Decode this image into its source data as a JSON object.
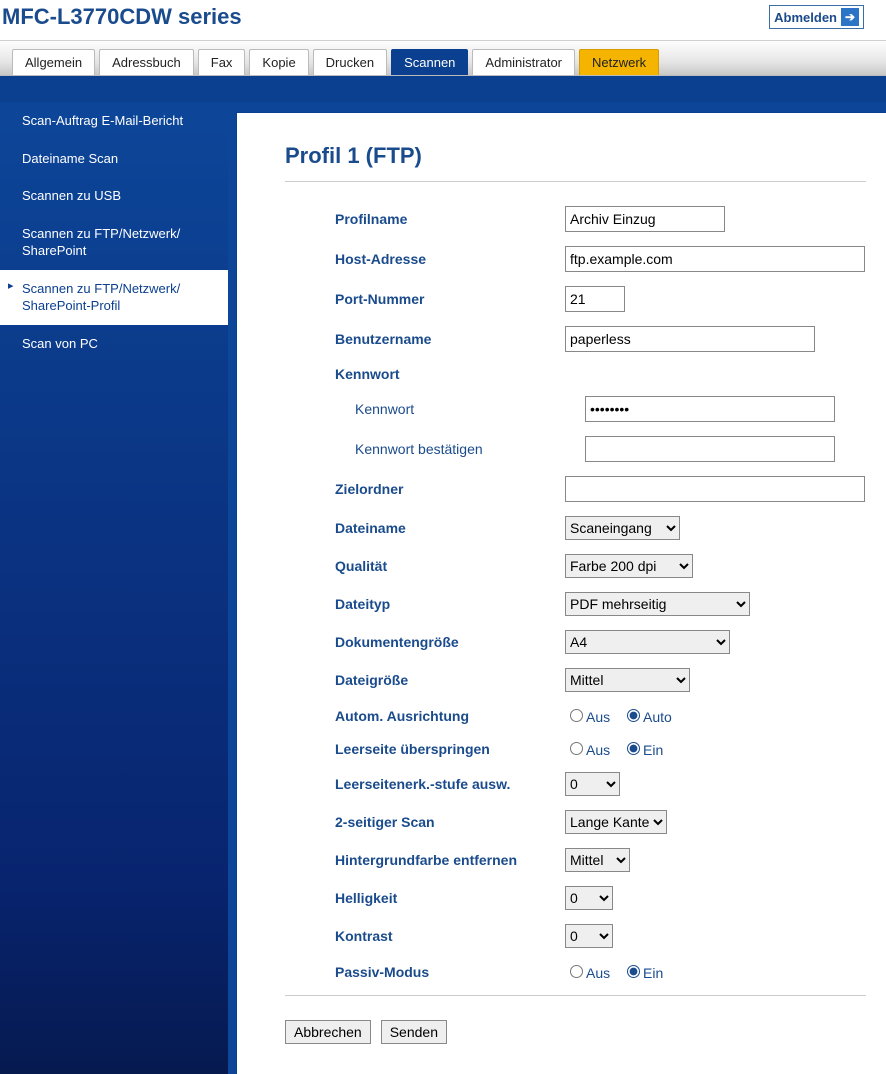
{
  "header": {
    "title": "MFC-L3770CDW series",
    "logout": "Abmelden"
  },
  "tabs": [
    {
      "label": "Allgemein"
    },
    {
      "label": "Adressbuch"
    },
    {
      "label": "Fax"
    },
    {
      "label": "Kopie"
    },
    {
      "label": "Drucken"
    },
    {
      "label": "Scannen",
      "active": true
    },
    {
      "label": "Administrator"
    },
    {
      "label": "Netzwerk",
      "net": true
    }
  ],
  "sidebar": [
    {
      "label": "Scan-Auftrag E-Mail-Bericht"
    },
    {
      "label": "Dateiname Scan"
    },
    {
      "label": "Scannen zu USB"
    },
    {
      "label": "Scannen zu FTP/Netzwerk/\nSharePoint"
    },
    {
      "label": "Scannen zu FTP/Netzwerk/\nSharePoint-Profil",
      "active": true
    },
    {
      "label": "Scan von PC"
    }
  ],
  "page": {
    "title": "Profil 1 (FTP)",
    "labels": {
      "profilname": "Profilname",
      "host": "Host-Adresse",
      "port": "Port-Nummer",
      "user": "Benutzername",
      "pw_section": "Kennwort",
      "pw": "Kennwort",
      "pw2": "Kennwort bestätigen",
      "folder": "Zielordner",
      "fname": "Dateiname",
      "quality": "Qualität",
      "ftype": "Dateityp",
      "docsize": "Dokumentengröße",
      "fsize": "Dateigröße",
      "auto_orient": "Autom. Ausrichtung",
      "skip_blank": "Leerseite überspringen",
      "blank_level": "Leerseitenerk.-stufe ausw.",
      "duplex": "2-seitiger Scan",
      "bg_remove": "Hintergrundfarbe entfernen",
      "bright": "Helligkeit",
      "contrast": "Kontrast",
      "passive": "Passiv-Modus"
    },
    "values": {
      "profilname": "Archiv Einzug",
      "host": "ftp.example.com",
      "port": "21",
      "user": "paperless",
      "pw": "••••••••",
      "pw2": "",
      "folder": "",
      "fname": "Scaneingang",
      "quality": "Farbe 200 dpi",
      "ftype": "PDF mehrseitig",
      "docsize": "A4",
      "fsize": "Mittel",
      "blank_level": "0",
      "duplex": "Lange Kante",
      "bg_remove": "Mittel",
      "bright": "0",
      "contrast": "0"
    },
    "radio": {
      "aus": "Aus",
      "ein": "Ein",
      "auto": "Auto",
      "auto_orient": "auto",
      "skip_blank": "ein",
      "passive": "ein"
    },
    "buttons": {
      "cancel": "Abbrechen",
      "submit": "Senden"
    }
  }
}
